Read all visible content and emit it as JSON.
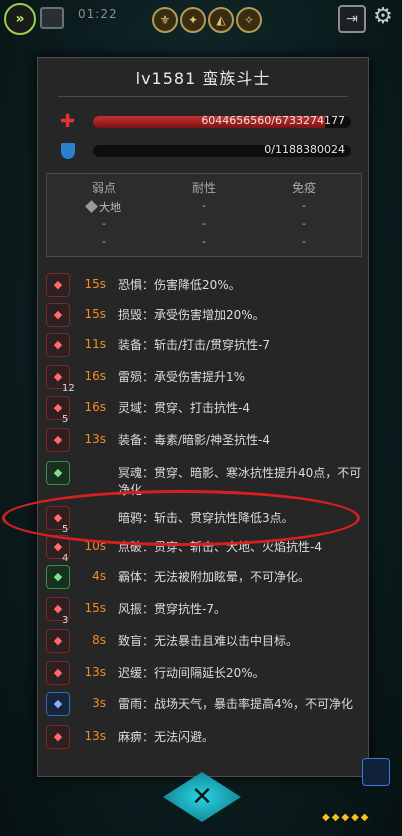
{
  "topbar": {
    "timer": "01:22",
    "fast_forward_glyph": "»",
    "icons": [
      "crest-1-icon",
      "crest-2-icon",
      "crest-3-icon",
      "crest-4-icon"
    ]
  },
  "enemy": {
    "title": "lv1581  蛮族斗士",
    "hp_current": 6044656560,
    "hp_max": 6733274177,
    "hp_text": "6044656560/6733274177",
    "hp_fraction": 0.898,
    "shield_text": "0/1188380024",
    "shield_fraction": 0
  },
  "resist_table": {
    "headers": [
      "弱点",
      "耐性",
      "免疫"
    ],
    "rows": [
      [
        "大地",
        "-",
        "-"
      ],
      [
        "-",
        "-",
        "-"
      ],
      [
        "-",
        "-",
        "-"
      ]
    ]
  },
  "statuses": [
    {
      "icon": "fear-icon",
      "color": "red",
      "stack": "",
      "duration": "15s",
      "text": "恐惧：伤害降低20%。"
    },
    {
      "icon": "damage-break-icon",
      "color": "red",
      "stack": "",
      "duration": "15s",
      "text": "损毁：承受伤害增加20%。"
    },
    {
      "icon": "armor-down-icon",
      "color": "red",
      "stack": "",
      "duration": "11s",
      "text": "装备：斩击/打击/贯穿抗性-7"
    },
    {
      "icon": "thunder-icon",
      "color": "red",
      "stack": "12",
      "duration": "16s",
      "text": "雷殒：承受伤害提升1%"
    },
    {
      "icon": "spirit-field-icon",
      "color": "red",
      "stack": "5",
      "duration": "16s",
      "text": "灵域：贯穿、打击抗性-4"
    },
    {
      "icon": "armor-down-icon",
      "color": "red",
      "stack": "",
      "duration": "13s",
      "text": "装备：毒素/暗影/神圣抗性-4"
    },
    {
      "icon": "underworld-soul-icon",
      "color": "green",
      "stack": "",
      "duration": "",
      "text": "冥魂：贯穿、暗影、寒冰抗性提升40点，不可净化"
    },
    {
      "icon": "dark-crow-icon",
      "color": "red",
      "stack": "5",
      "duration": "",
      "text": "暗鸦：斩击、贯穿抗性降低3点。"
    },
    {
      "icon": "ignite-icon",
      "color": "red",
      "stack": "4",
      "duration": "10s",
      "text": "点破：贯穿、斩击、大地、火焰抗性-4"
    },
    {
      "icon": "overlord-icon",
      "color": "green",
      "stack": "",
      "duration": "4s",
      "text": "霸体：无法被附加眩晕，不可净化。"
    },
    {
      "icon": "wind-shock-icon",
      "color": "red",
      "stack": "3",
      "duration": "15s",
      "text": "风振：贯穿抗性-7。"
    },
    {
      "icon": "blind-icon",
      "color": "red",
      "stack": "",
      "duration": "8s",
      "text": "致盲：无法暴击且难以击中目标。"
    },
    {
      "icon": "slow-icon",
      "color": "red",
      "stack": "",
      "duration": "13s",
      "text": "迟缓：行动间隔延长20%。"
    },
    {
      "icon": "thunder-rain-icon",
      "color": "blue",
      "stack": "",
      "duration": "3s",
      "text": "雷雨：战场天气，暴击率提高4%，不可净化"
    },
    {
      "icon": "paralysis-icon",
      "color": "red",
      "stack": "",
      "duration": "13s",
      "text": "麻痹：无法闪避。"
    }
  ],
  "bottom": {
    "close_glyph": "✕",
    "dots": "◆◆◆◆◆"
  }
}
